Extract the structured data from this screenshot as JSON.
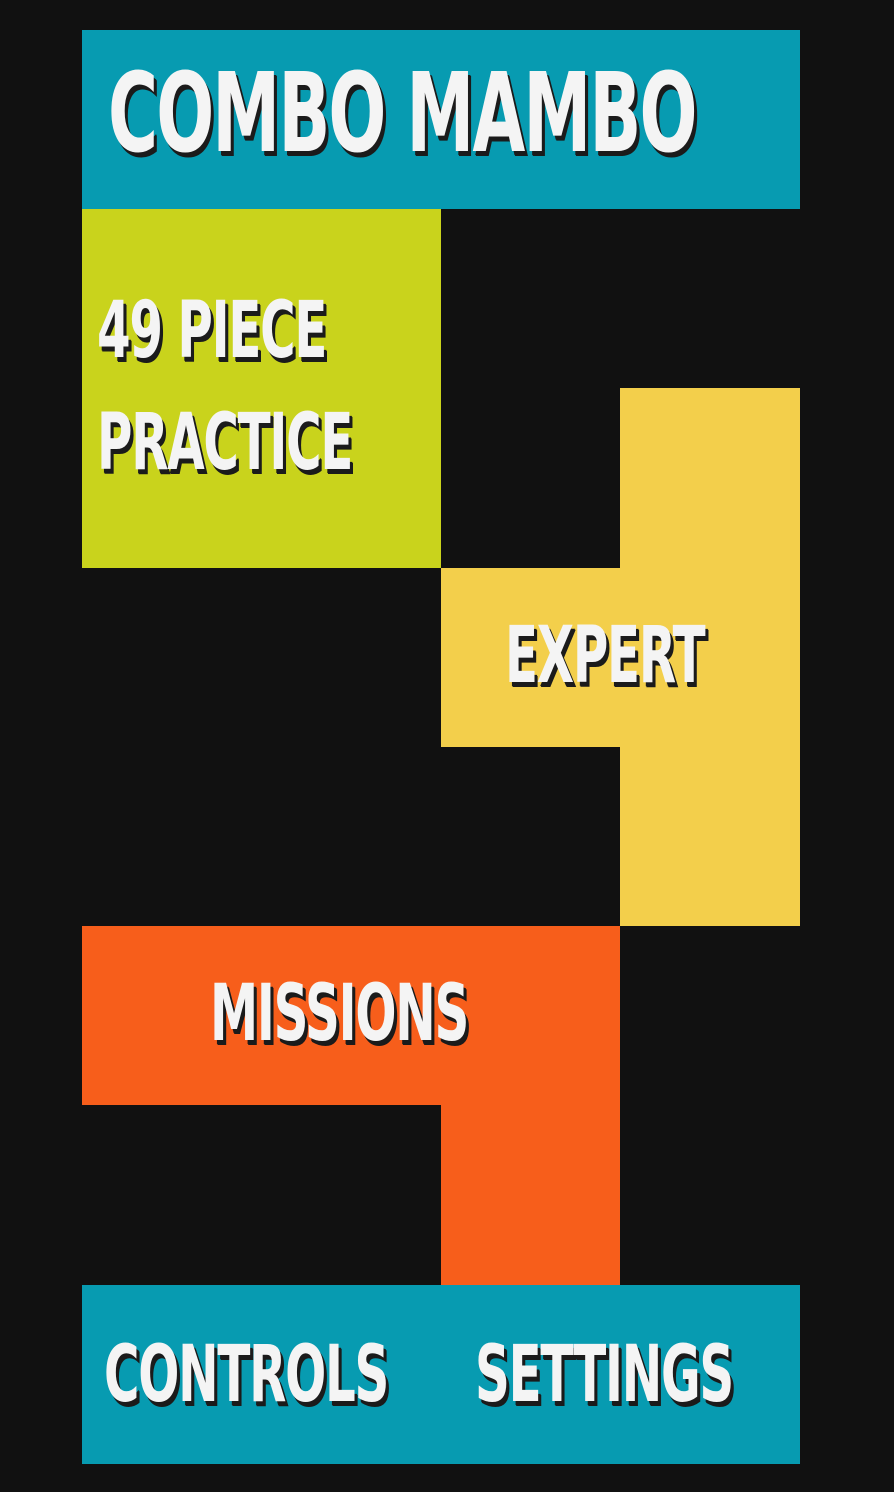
{
  "title": "COMBO MAMBO",
  "menu": {
    "practice": {
      "line1": "49 PIECE",
      "line2": "PRACTICE",
      "color": "#c9d31c"
    },
    "expert": {
      "label": "EXPERT",
      "color": "#f3cf4b"
    },
    "missions": {
      "label": "MISSIONS",
      "color": "#f75e1b"
    },
    "controls": {
      "label": "CONTROLS"
    },
    "settings": {
      "label": "SETTINGS"
    }
  },
  "colors": {
    "background": "#111111",
    "bar": "#079bb1",
    "text": "#f4f4f4",
    "text_shadow": "#1b1b1b"
  }
}
